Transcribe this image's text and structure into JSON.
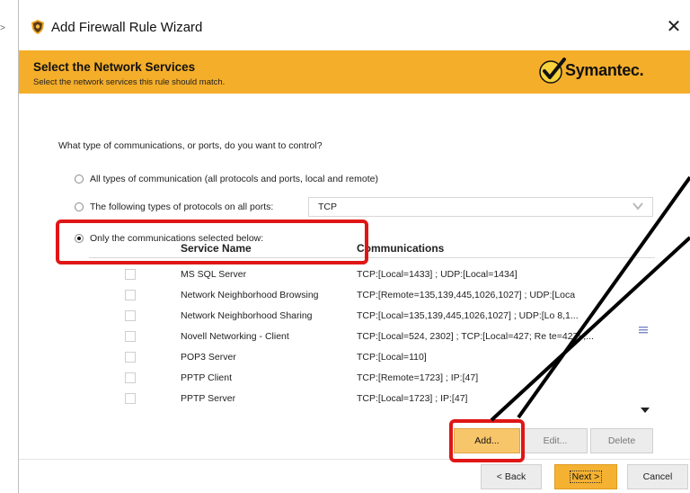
{
  "window": {
    "title": "Add Firewall Rule Wizard",
    "close_glyph": "✕"
  },
  "banner": {
    "title": "Select the Network Services",
    "subtitle": "Select the network services this rule should match.",
    "logo_text": "Symantec.",
    "color": "#f5ae2a"
  },
  "question": "What type of communications, or ports, do you want to control?",
  "options": [
    {
      "label": "All types of communication (all protocols and ports, local and remote)",
      "selected": false
    },
    {
      "label": "The following types of protocols on all ports:",
      "selected": false
    },
    {
      "label": "Only the communications selected below:",
      "selected": true
    }
  ],
  "protocol_select": {
    "value": "TCP"
  },
  "table": {
    "headers": [
      "Service Name",
      "Communications"
    ],
    "rows": [
      {
        "service": "MS SQL Server",
        "communications": "TCP:[Local=1433] ; UDP:[Local=1434]",
        "checked": false
      },
      {
        "service": "Network Neighborhood Browsing",
        "communications": "TCP:[Remote=135,139,445,1026,1027] ; UDP:[Loca",
        "checked": false
      },
      {
        "service": "Network Neighborhood Sharing",
        "communications": "TCP:[Local=135,139,445,1026,1027] ; UDP:[Lo      8,1...",
        "checked": false
      },
      {
        "service": "Novell Networking - Client",
        "communications": "TCP:[Local=524, 2302] ; TCP:[Local=427; Re      te=427] ;...",
        "checked": false
      },
      {
        "service": "POP3 Server",
        "communications": "TCP:[Local=110]",
        "checked": false
      },
      {
        "service": "PPTP Client",
        "communications": "TCP:[Remote=1723] ; IP:[47]",
        "checked": false
      },
      {
        "service": "PPTP Server",
        "communications": "TCP:[Local=1723] ; IP:[47]",
        "checked": false
      }
    ]
  },
  "buttons": {
    "add": "Add...",
    "edit": "Edit...",
    "delete": "Delete",
    "back": "< Back",
    "next": "Next >",
    "cancel": "Cancel"
  },
  "colors": {
    "accent": "#f5ae2a",
    "highlight": "#e01616"
  },
  "icons": {
    "app": "shield-icon",
    "close": "close-icon",
    "logo": "checkmark-logo-icon",
    "dropdown": "chevron-down-icon"
  }
}
